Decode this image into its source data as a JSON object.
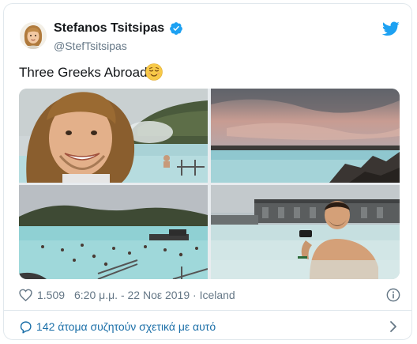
{
  "author": {
    "name": "Stefanos Tsitsipas",
    "handle": "@StefTsitsipas",
    "verified": true
  },
  "tweet": {
    "text": "Three Greeks Abroad",
    "emoji": "relieved-face-emoji",
    "photo_count": 4
  },
  "meta": {
    "likes": "1.509",
    "timestamp": "6:20 μ.μ. - 22 Νοε 2019 · Iceland"
  },
  "footer": {
    "discussion_label": "142 άτομα συζητούν σχετικά με αυτό"
  },
  "colors": {
    "twitter_blue": "#1da1f2",
    "link_blue": "#1b6fa8",
    "secondary_text": "#657786",
    "border": "#e1e8ed"
  },
  "icons": [
    "twitter-logo-icon",
    "verified-badge-icon",
    "heart-icon",
    "info-icon",
    "speech-bubble-icon",
    "chevron-right-icon"
  ]
}
